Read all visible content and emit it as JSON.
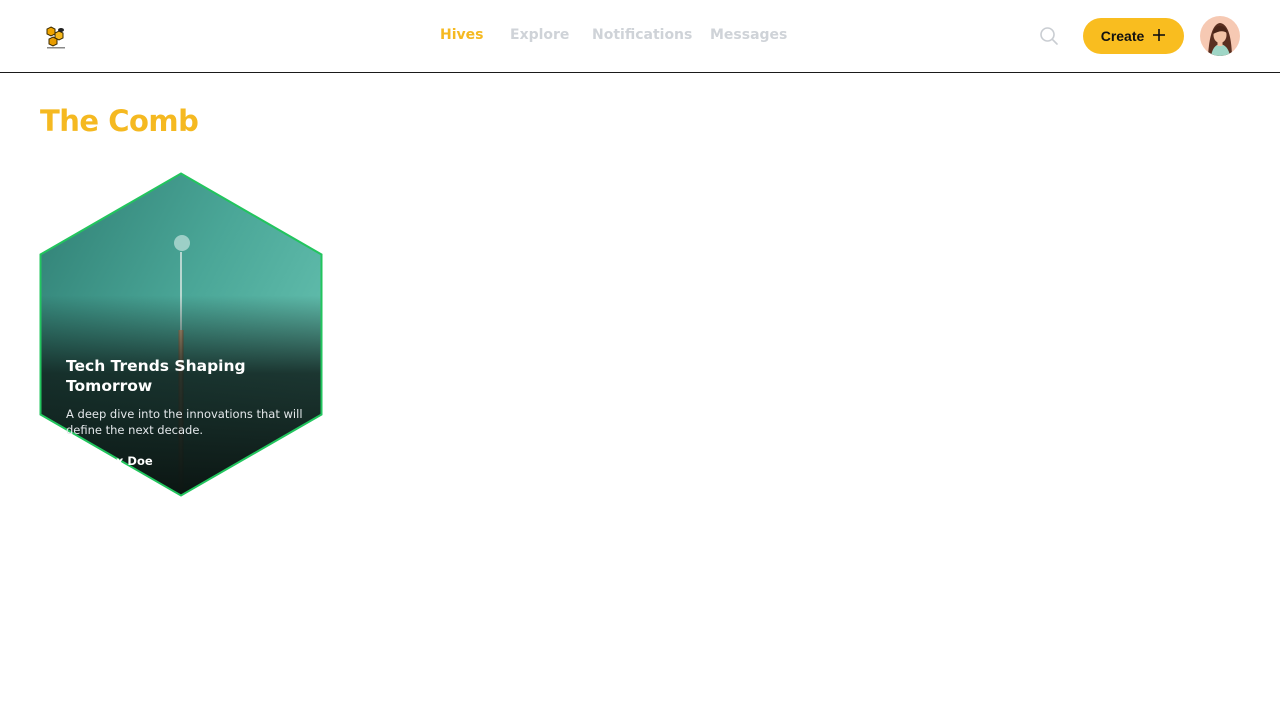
{
  "nav": {
    "items": [
      {
        "label": "Hives",
        "active": true
      },
      {
        "label": "Explore",
        "active": false
      },
      {
        "label": "Notifications",
        "active": false
      },
      {
        "label": "Messages",
        "active": false
      }
    ]
  },
  "header": {
    "search_icon": "search-icon",
    "create_label": "Create",
    "create_icon": "plus-icon",
    "accent_color": "#f9bd1f"
  },
  "page": {
    "title": "The Comb"
  },
  "cards": [
    {
      "title": "Tech Trends Shaping Tomorrow",
      "description": "A deep dive into the innovations that will define the next decade.",
      "author": "x Doe",
      "border_color": "#22c55e"
    }
  ]
}
